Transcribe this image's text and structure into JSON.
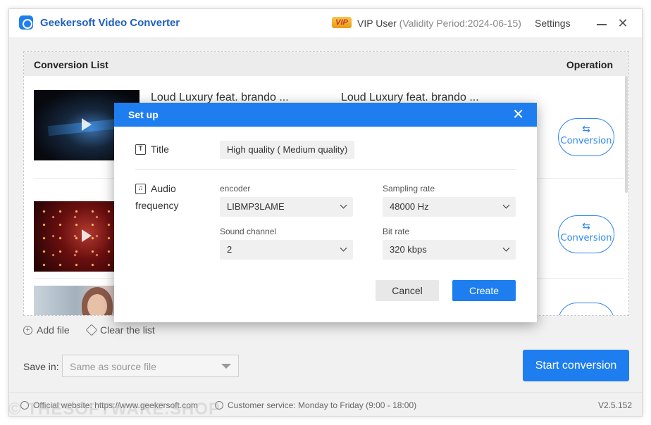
{
  "app": {
    "title": "Geekersoft Video Converter",
    "vip_badge": "VIP",
    "vip_user": "VIP User ",
    "vip_validity": "(Validity Period:2024-06-15)",
    "settings": "Settings",
    "brand_color": "#1e7ef0"
  },
  "conversion_list": {
    "header_title": "Conversion List",
    "header_operation": "Operation",
    "items": [
      {
        "name_left": "Loud Luxury feat. brando ...",
        "name_right": "Loud Luxury feat. brando ...",
        "action": "Conversion"
      },
      {
        "name_left": "",
        "name_right": "",
        "action": "Conversion"
      },
      {
        "name_left": "",
        "name_right": "",
        "action": ""
      }
    ],
    "add_file": "Add file",
    "clear_list": "Clear the list"
  },
  "save": {
    "label": "Save in:",
    "placeholder": "Same as source file"
  },
  "start_button": "Start conversion",
  "footer": {
    "website": "Official website: https://www.geekersoft.com",
    "service": "Customer service: Monday to Friday (9:00 - 18:00)",
    "version": "V2.5.152"
  },
  "dialog": {
    "title": "Set up",
    "title_label": "Title",
    "title_value": "High quality ( Medium quality)",
    "audio_label_line1": "Audio",
    "audio_label_line2": "frequency",
    "fields": {
      "encoder": {
        "label": "encoder",
        "value": "LIBMP3LAME"
      },
      "sampling_rate": {
        "label": "Sampling rate",
        "value": "48000 Hz"
      },
      "sound_channel": {
        "label": "Sound channel",
        "value": "2"
      },
      "bit_rate": {
        "label": "Bit rate",
        "value": "320 kbps"
      }
    },
    "cancel": "Cancel",
    "create": "Create"
  },
  "watermark": "© THESOFTWARE.SHOP"
}
